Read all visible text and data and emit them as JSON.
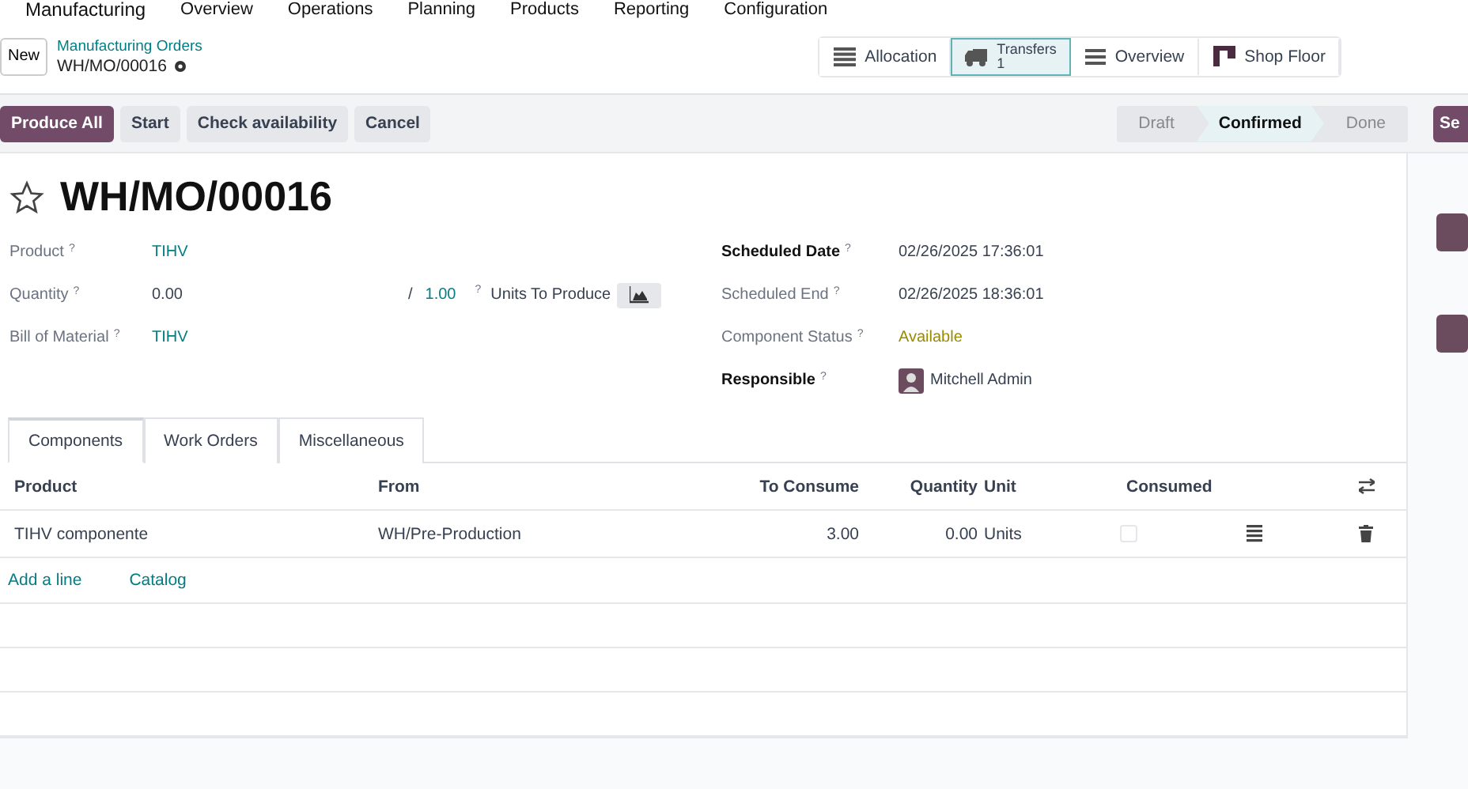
{
  "app_menu": {
    "app": "Manufacturing",
    "items": [
      "Overview",
      "Operations",
      "Planning",
      "Products",
      "Reporting",
      "Configuration"
    ]
  },
  "control_panel": {
    "new_button": "New",
    "breadcrumb": "Manufacturing Orders",
    "record": "WH/MO/00016",
    "smart_buttons": [
      {
        "kind": "list",
        "label": "Allocation",
        "selected": false
      },
      {
        "kind": "truck",
        "label": "Transfers",
        "count": "1",
        "selected": true
      },
      {
        "kind": "lines",
        "label": "Overview",
        "selected": false
      },
      {
        "kind": "board",
        "label": "Shop Floor",
        "selected": false
      }
    ]
  },
  "actions": [
    {
      "label": "Produce All",
      "kind": "primary"
    },
    {
      "label": "Start",
      "kind": "secondary"
    },
    {
      "label": "Check availability",
      "kind": "secondary"
    },
    {
      "label": "Cancel",
      "kind": "secondary"
    }
  ],
  "stages": [
    {
      "label": "Draft",
      "selected": false
    },
    {
      "label": "Confirmed",
      "selected": true
    },
    {
      "label": "Done",
      "selected": false
    }
  ],
  "chatter": {
    "send_button": "Se"
  },
  "form": {
    "starred": false,
    "title": "WH/MO/00016",
    "left_fields": [
      {
        "label": "Product",
        "help": "?",
        "value": "TIHV",
        "kind": "link"
      },
      {
        "label": "Quantity",
        "help": "?",
        "value": "0.00",
        "kind": "quantity",
        "separator": "/",
        "target": "1.00",
        "target_help": "?",
        "unit": "Units To Produce"
      },
      {
        "label": "Bill of Material",
        "help": "?",
        "value": "TIHV",
        "kind": "link"
      }
    ],
    "right_fields": [
      {
        "label": "Scheduled Date",
        "help": "?",
        "value": "02/26/2025 17:36:01",
        "kind": "text",
        "required": true
      },
      {
        "label": "Scheduled End",
        "help": "?",
        "value": "02/26/2025 18:36:01",
        "kind": "text",
        "required": false
      },
      {
        "label": "Component Status",
        "help": "?",
        "value": "Available",
        "kind": "status",
        "required": false
      },
      {
        "label": "Responsible",
        "help": "?",
        "value": "Mitchell Admin",
        "kind": "user",
        "required": true
      }
    ],
    "tabs": [
      {
        "label": "Components",
        "selected": true
      },
      {
        "label": "Work Orders",
        "selected": false
      },
      {
        "label": "Miscellaneous",
        "selected": false
      }
    ],
    "table": {
      "columns": [
        "Product",
        "From",
        "To Consume",
        "Quantity",
        "Unit",
        "Consumed"
      ],
      "rows": [
        {
          "product": "TIHV componente",
          "from": "WH/Pre-Production",
          "to_consume": "3.00",
          "quantity": "0.00",
          "unit": "Units",
          "consumed": false
        }
      ],
      "links": [
        "Add a line",
        "Catalog"
      ]
    }
  }
}
